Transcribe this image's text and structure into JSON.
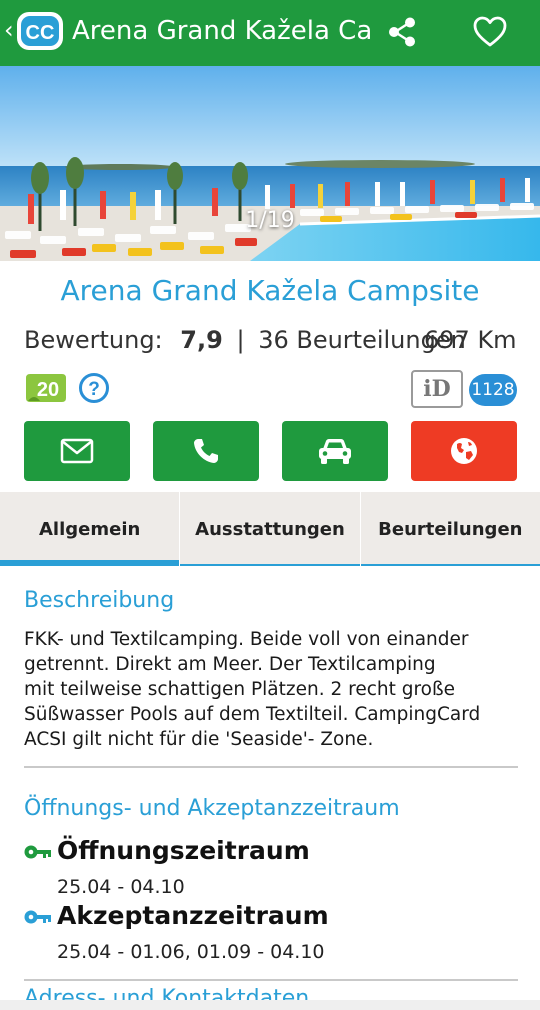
{
  "app": {
    "title": "Arena Grand Kažela Ca…",
    "back_glyph": "‹",
    "logo_text": "CC"
  },
  "hero": {
    "photo_counter": "1/19"
  },
  "campsite": {
    "name": "Arena Grand Kažela Campsite",
    "rating_label": "Bewertung:",
    "rating_value": "7,9",
    "separator": "|",
    "review_count": "36 Beurteilungen",
    "distance": "697 Km",
    "age_badge": "20",
    "id_badge": "iD",
    "id_count": "1128"
  },
  "actions": [
    {
      "icon": "envelope-icon",
      "color": "#1f9a3e"
    },
    {
      "icon": "phone-icon",
      "color": "#1f9a3e"
    },
    {
      "icon": "car-icon",
      "color": "#1f9a3e"
    },
    {
      "icon": "globe-icon",
      "color": "#ee3b24"
    }
  ],
  "tabs": [
    {
      "label": "Allgemein",
      "active": true
    },
    {
      "label": "Ausstattungen",
      "active": false
    },
    {
      "label": "Beurteilungen",
      "active": false
    }
  ],
  "sections": {
    "description_title": "Beschreibung",
    "description_lines": [
      "FKK- und Textilcamping. Beide voll von einander",
      "getrennt. Direkt am Meer. Der Textilcamping",
      "mit teilweise schattigen Plätzen. 2 recht große",
      "Süßwasser Pools auf dem Textilteil. CampingCard",
      "ACSI gilt nicht für die 'Seaside'- Zone."
    ],
    "periods_title": "Öffnungs- und Akzeptanzzeitraum",
    "opening_label": "Öffnungszeitraum",
    "opening_dates": "25.04 - 04.10",
    "acceptance_label": "Akzeptanzzeitraum",
    "acceptance_dates": "25.04 - 01.06, 01.09 - 04.10",
    "address_title": "Adress- und Kontaktdaten"
  },
  "colors": {
    "brand_green": "#1f9a3e",
    "accent_blue": "#2a9fd6",
    "alert_red": "#ee3b24"
  }
}
